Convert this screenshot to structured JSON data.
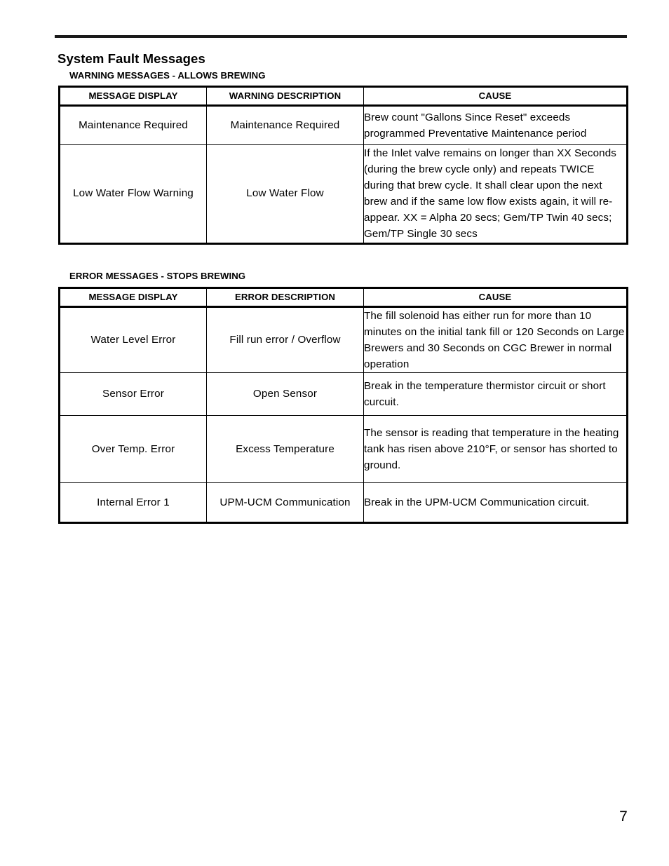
{
  "document": {
    "page_title": "System Fault Messages",
    "page_number": "7"
  },
  "warning_section": {
    "caption": "WARNING MESSAGES - ALLOWS BREWING",
    "columns": [
      "MESSAGE DISPLAY",
      "WARNING DESCRIPTION",
      "CAUSE"
    ],
    "rows": [
      {
        "message_display": "Maintenance Required",
        "description": "Maintenance Required",
        "cause": "Brew count \"Gallons Since Reset\" exceeds programmed Preventative Maintenance period"
      },
      {
        "message_display": "Low Water Flow Warning",
        "description": "Low Water Flow",
        "cause": "If the Inlet valve remains on longer than XX Seconds (during the brew cycle only) and repeats TWICE during that brew cycle. It shall clear upon the next brew and if the same low flow exists again, it will re-appear. XX = Alpha 20 secs; Gem/TP Twin 40 secs; Gem/TP Single 30 secs"
      }
    ]
  },
  "error_section": {
    "caption": "ERROR MESSAGES - STOPS BREWING",
    "columns": [
      "MESSAGE DISPLAY",
      "ERROR DESCRIPTION",
      "CAUSE"
    ],
    "rows": [
      {
        "message_display": "Water Level Error",
        "description": "Fill run error / Overflow",
        "cause": "The fill solenoid has either run for more than 10 minutes on the initial tank fill or 120 Seconds on Large Brewers and 30 Seconds on CGC Brewer in normal operation"
      },
      {
        "message_display": "Sensor Error",
        "description": "Open Sensor",
        "cause": "Break in the temperature thermistor circuit or short curcuit."
      },
      {
        "message_display": "Over Temp. Error",
        "description": "Excess Temperature",
        "cause": "The sensor is reading that temperature in the heating tank has risen above 210°F, or sensor has shorted to ground."
      },
      {
        "message_display": "Internal Error 1",
        "description": "UPM-UCM Communication",
        "cause": "Break in the UPM-UCM Communication circuit."
      }
    ]
  }
}
